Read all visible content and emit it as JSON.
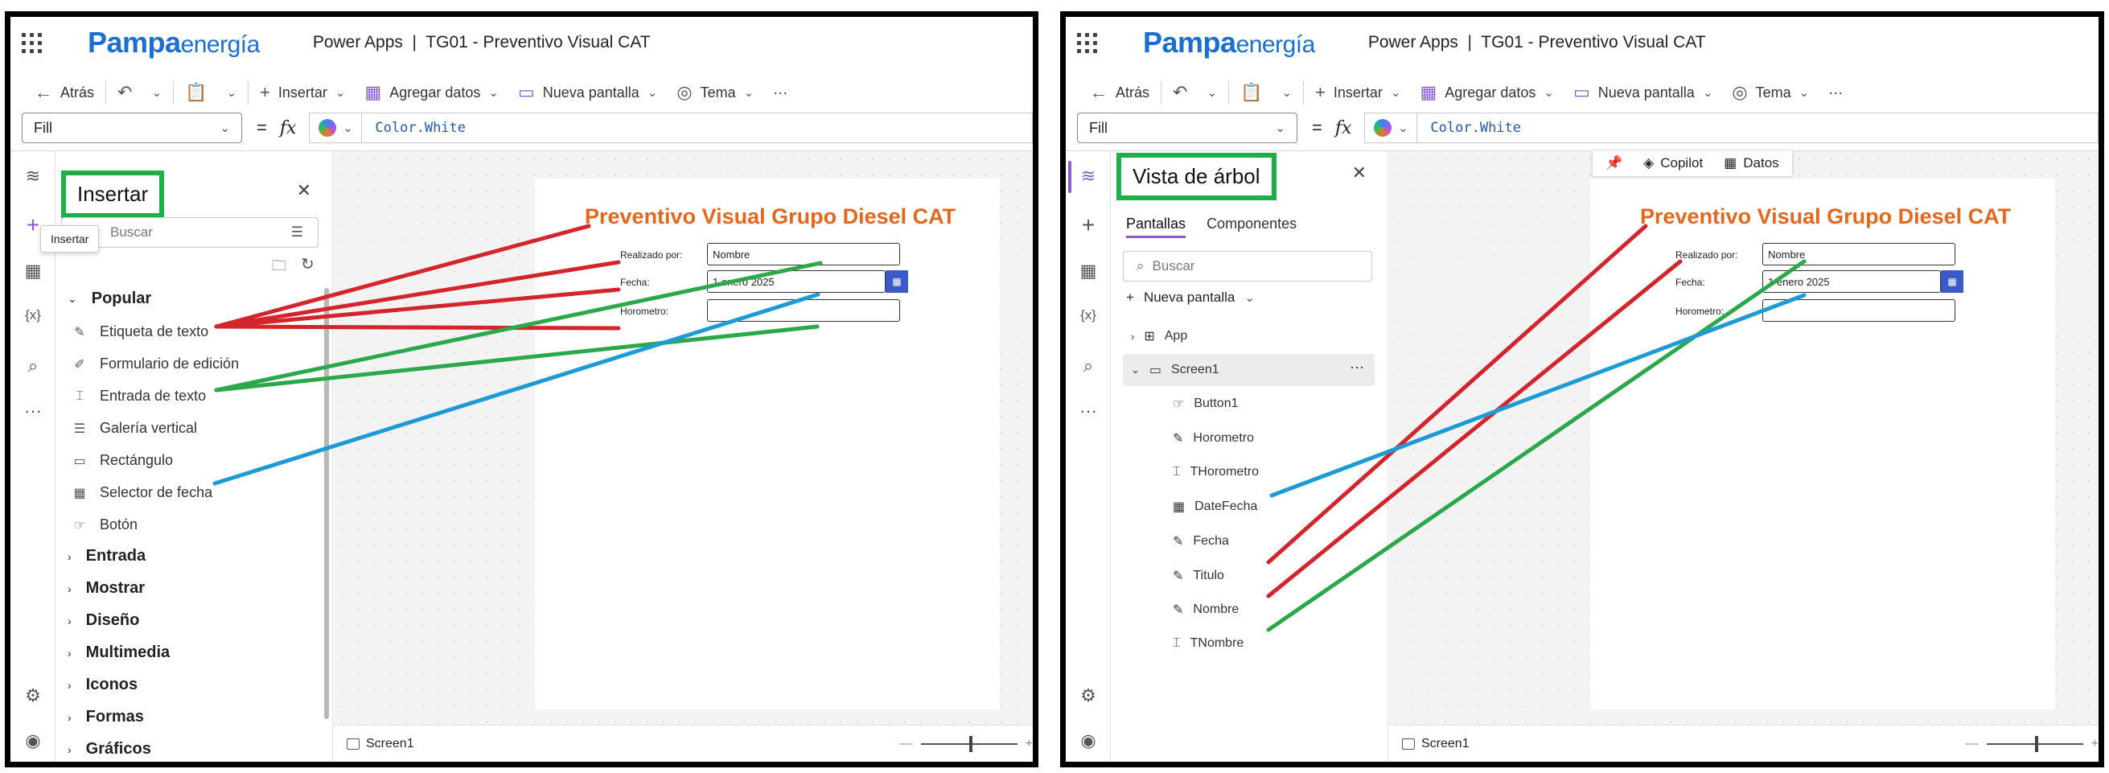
{
  "brand": {
    "part1": "Pampa",
    "part2": "energía"
  },
  "app_title": "Power Apps  |  TG01 - Preventivo Visual CAT",
  "toolbar": {
    "back": "Atrás",
    "insert": "Insertar",
    "add_data": "Agregar datos",
    "new_screen": "Nueva pantalla",
    "theme": "Tema",
    "more": "···"
  },
  "formula_bar": {
    "property": "Fill",
    "equals": "=",
    "fx": "fx",
    "formula": "Color.White"
  },
  "insert_panel": {
    "title": "Insertar",
    "search_placeholder": "Buscar",
    "tooltip": "Insertar",
    "popular_label": "Popular",
    "popular_items": [
      {
        "label": "Etiqueta de texto",
        "icon": "label-edit-icon"
      },
      {
        "label": "Formulario de edición",
        "icon": "form-icon"
      },
      {
        "label": "Entrada de texto",
        "icon": "text-input-icon"
      },
      {
        "label": "Galería vertical",
        "icon": "gallery-icon"
      },
      {
        "label": "Rectángulo",
        "icon": "rectangle-icon"
      },
      {
        "label": "Selector de fecha",
        "icon": "calendar-icon"
      },
      {
        "label": "Botón",
        "icon": "button-icon"
      }
    ],
    "categories": [
      "Entrada",
      "Mostrar",
      "Diseño",
      "Multimedia",
      "Iconos",
      "Formas",
      "Gráficos"
    ]
  },
  "tree_panel": {
    "title": "Vista de árbol",
    "tabs": [
      "Pantallas",
      "Componentes"
    ],
    "search_placeholder": "Buscar",
    "new_screen": "Nueva pantalla",
    "app_label": "App",
    "screen_label": "Screen1",
    "screen_more": "···",
    "children": [
      {
        "label": "Button1",
        "icon": "button-icon"
      },
      {
        "label": "Horometro",
        "icon": "label-edit-icon"
      },
      {
        "label": "THorometro",
        "icon": "text-input-icon"
      },
      {
        "label": "DateFecha",
        "icon": "calendar-icon"
      },
      {
        "label": "Fecha",
        "icon": "label-edit-icon"
      },
      {
        "label": "Titulo",
        "icon": "label-edit-icon"
      },
      {
        "label": "Nombre",
        "icon": "label-edit-icon"
      },
      {
        "label": "TNombre",
        "icon": "text-input-icon"
      }
    ]
  },
  "canvas_toolbar": {
    "copilot": "Copilot",
    "data": "Datos"
  },
  "form": {
    "title": "Preventivo Visual Grupo Diesel CAT",
    "realizado_label": "Realizado por:",
    "realizado_value": "Nombre",
    "fecha_label": "Fecha:",
    "fecha_value": "1 enero 2025",
    "horometro_label": "Horometro:",
    "horometro_value": ""
  },
  "status": {
    "screen": "Screen1",
    "zoom_minus": "—",
    "zoom_plus": "+"
  },
  "colors": {
    "accent_purple": "#8a5cc9",
    "highlight_green": "#1fae47",
    "line_red": "#d3252b",
    "line_green": "#2aa84a",
    "line_blue": "#1e9bd6",
    "form_title_orange": "#e5671e"
  }
}
